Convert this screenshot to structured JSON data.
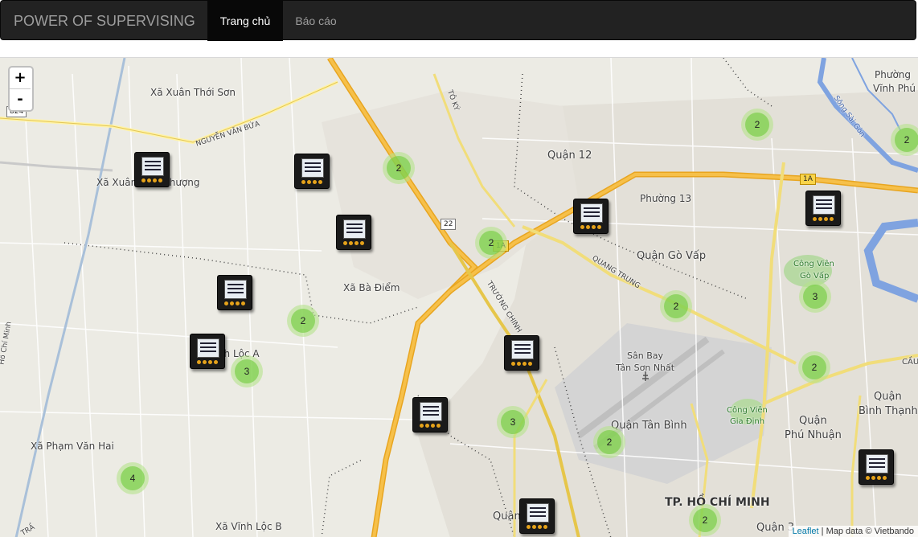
{
  "navbar": {
    "brand": "POWER OF SUPERVISING",
    "items": [
      {
        "label": "Trang chủ",
        "active": true
      },
      {
        "label": "Báo cáo",
        "active": false
      }
    ]
  },
  "map": {
    "zoom_in": "+",
    "zoom_out": "-",
    "attribution": {
      "leaflet": "Leaflet",
      "text": " | Map data © Vietbando"
    },
    "places": {
      "xuan_thoi_son": "Xã Xuân Thới Sơn",
      "xuan_thoi_thuong": "Xã Xuân Thới Thượng",
      "ba_diem": "Xã Bà Điểm",
      "vinh_loc_a": "Xã Vĩnh Lộc A",
      "pham_van_hai": "Xã Phạm Văn Hai",
      "vinh_loc_b": "Xã Vĩnh Lộc B",
      "quan_12": "Quận 12",
      "phuong_13": "Phường 13",
      "go_vap": "Quận Gò Vấp",
      "san_bay_1": "Sân Bay",
      "san_bay_2": "Tân Sơn Nhất",
      "tan_binh": "Quận Tân Bình",
      "phu_nhuan_1": "Quận",
      "phu_nhuan_2": "Phú Nhuận",
      "binh_thanh_1": "Quận",
      "binh_thanh_2": "Bình Thạnh",
      "tp_hcm": "TP. HỒ CHÍ MINH",
      "quan_3": "Quận 3",
      "vinh_phu_1": "Phường",
      "vinh_phu_2": "Vĩnh Phú",
      "cv_go_vap_1": "Công Viên",
      "cv_go_vap_2": "Gò Vấp",
      "cv_gia_dinh_1": "Công Viên",
      "cv_gia_dinh_2": "Gia Định",
      "quan_partial": "Quận",
      "cau": "CẦU"
    },
    "roads": {
      "nguyen_van_bua": "NGUYỄN VĂN BỨA",
      "to_ky": "TÔ KÝ",
      "truong_chinh": "TRƯỜNG CHINH",
      "quang_trung": "QUANG TRUNG",
      "song_sai_gon": "Sông Sài Gòn",
      "ho_chi_minh": "Hồ Chí Minh",
      "tran": "TRẦ"
    },
    "shields": {
      "r824": "824",
      "r22": "22",
      "r1a": "1A",
      "r1a_b": "1A"
    },
    "clusters": [
      "2",
      "2",
      "2",
      "2",
      "3",
      "2",
      "2",
      "3",
      "2",
      "3",
      "2",
      "4",
      "2"
    ],
    "meter_count": 11
  }
}
